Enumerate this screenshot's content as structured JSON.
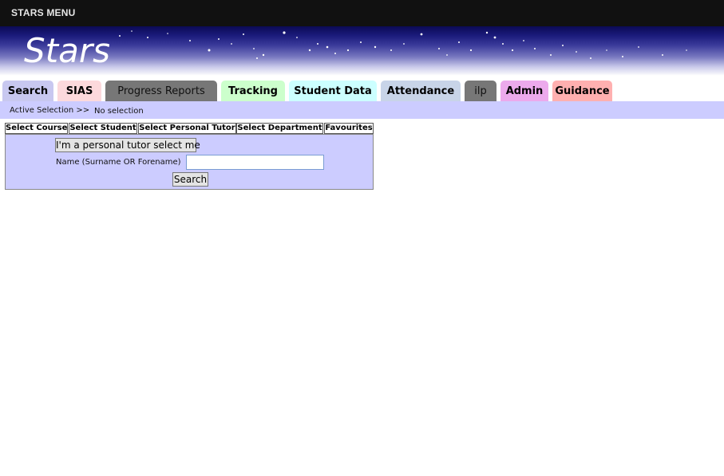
{
  "topbar": {
    "title": "STARS MENU"
  },
  "banner": {
    "title": "Stars"
  },
  "tabs": [
    {
      "label": "Search",
      "color": "#c8c8f0"
    },
    {
      "label": "SIAS",
      "color": "#fcd9dc"
    },
    {
      "label": "Progress Reports",
      "color": "#777777"
    },
    {
      "label": "Tracking",
      "color": "#ccffcc"
    },
    {
      "label": "Student Data",
      "color": "#ccffff"
    },
    {
      "label": "Attendance",
      "color": "#c8d4e8"
    },
    {
      "label": "ilp",
      "color": "#777777"
    },
    {
      "label": "Admin",
      "color": "#ecaaec"
    },
    {
      "label": "Guidance",
      "color": "#ffb0b0"
    }
  ],
  "selection": {
    "label": "Active Selection >>",
    "value": "No selection",
    "bar_color": "#ccccff"
  },
  "panel": {
    "tabs": [
      {
        "label": "Select Course"
      },
      {
        "label": "Select Student"
      },
      {
        "label": "Select Personal Tutor"
      },
      {
        "label": "Select Department"
      },
      {
        "label": "Favourites"
      }
    ],
    "tutor_button": "I'm a personal tutor select me",
    "name_label": "Name (Surname OR Forename)",
    "name_value": "",
    "search_button": "Search"
  }
}
